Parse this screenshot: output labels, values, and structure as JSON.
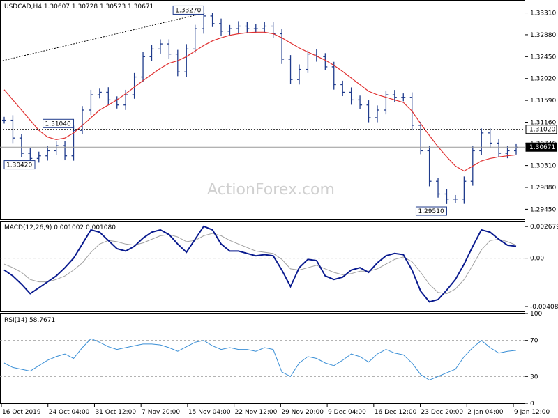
{
  "chart_data": [
    {
      "type": "ohlc",
      "info": "USDCAD,H4  1.30607 1.30728 1.30523 1.30671",
      "ylim": [
        1.2925,
        1.3355
      ],
      "y_ticks": [
        "1.33310",
        "1.32880",
        "1.32450",
        "1.32020",
        "1.31590",
        "1.31160",
        "1.30740",
        "1.30310",
        "1.29880",
        "1.29450"
      ],
      "current_price": "1.30671",
      "level_line": "1.31020",
      "annotations": [
        {
          "text": "1.33270",
          "value": 1.3327
        },
        {
          "text": "1.30420",
          "value": 1.3042
        },
        {
          "text": "1.31040",
          "value": 1.3104
        },
        {
          "text": "1.29510",
          "value": 1.2951
        }
      ],
      "series": [
        {
          "name": "close",
          "values": [
            1.312,
            1.3085,
            1.3055,
            1.3045,
            1.305,
            1.306,
            1.307,
            1.305,
            1.31,
            1.314,
            1.317,
            1.3175,
            1.316,
            1.315,
            1.317,
            1.3205,
            1.3245,
            1.326,
            1.327,
            1.325,
            1.3215,
            1.326,
            1.33,
            1.3325,
            1.331,
            1.3295,
            1.33,
            1.3305,
            1.33,
            1.33,
            1.3305,
            1.329,
            1.324,
            1.32,
            1.322,
            1.325,
            1.3245,
            1.3225,
            1.319,
            1.3175,
            1.316,
            1.315,
            1.3125,
            1.314,
            1.317,
            1.3165,
            1.3165,
            1.311,
            1.306,
            1.3,
            1.2975,
            1.2965,
            1.2965,
            1.3,
            1.306,
            1.3095,
            1.3075,
            1.3055,
            1.306,
            1.3067
          ]
        },
        {
          "name": "moving average",
          "values": [
            1.318,
            1.316,
            1.314,
            1.312,
            1.31,
            1.3087,
            1.3082,
            1.3085,
            1.3095,
            1.311,
            1.3125,
            1.314,
            1.315,
            1.316,
            1.3172,
            1.3185,
            1.3198,
            1.321,
            1.3222,
            1.3232,
            1.3237,
            1.3245,
            1.3256,
            1.3267,
            1.3276,
            1.3282,
            1.3287,
            1.329,
            1.3292,
            1.3293,
            1.3293,
            1.329,
            1.3282,
            1.3272,
            1.3262,
            1.3254,
            1.3246,
            1.3238,
            1.3228,
            1.3216,
            1.3203,
            1.319,
            1.3177,
            1.317,
            1.3165,
            1.316,
            1.3155,
            1.3138,
            1.3113,
            1.309,
            1.3068,
            1.3048,
            1.303,
            1.302,
            1.303,
            1.304,
            1.3045,
            1.3048,
            1.305,
            1.3052
          ]
        }
      ]
    },
    {
      "type": "line",
      "info": "MACD(12,26,9) 0.001002 0.001080",
      "ylim": [
        -0.0045,
        0.0031
      ],
      "y_ticks": [
        "0.002679",
        "0.00",
        "-0.004086"
      ],
      "series": [
        {
          "name": "MACD",
          "values": [
            -0.001,
            -0.0015,
            -0.0022,
            -0.003,
            -0.0025,
            -0.002,
            -0.0015,
            -0.0008,
            0.0,
            0.0012,
            0.0024,
            0.0022,
            0.0015,
            0.0008,
            0.0006,
            0.001,
            0.0017,
            0.0022,
            0.0024,
            0.002,
            0.0012,
            0.0005,
            0.0016,
            0.0027,
            0.0024,
            0.0012,
            0.0006,
            0.0006,
            0.0004,
            0.0002,
            0.0003,
            0.0002,
            -0.001,
            -0.0024,
            -0.0008,
            -0.0001,
            -0.0002,
            -0.0015,
            -0.0018,
            -0.0016,
            -0.001,
            -0.0008,
            -0.0012,
            -0.0004,
            0.0002,
            0.0004,
            0.0003,
            -0.001,
            -0.0028,
            -0.0037,
            -0.0035,
            -0.0027,
            -0.0018,
            -0.0005,
            0.001,
            0.0024,
            0.0022,
            0.0016,
            0.0011,
            0.001
          ]
        },
        {
          "name": "signal",
          "values": [
            -0.0005,
            -0.0008,
            -0.0012,
            -0.0018,
            -0.002,
            -0.002,
            -0.0018,
            -0.0015,
            -0.001,
            -0.0004,
            0.0005,
            0.0012,
            0.0015,
            0.0014,
            0.0012,
            0.0011,
            0.0013,
            0.0016,
            0.0019,
            0.002,
            0.0018,
            0.0014,
            0.0015,
            0.0019,
            0.0021,
            0.0019,
            0.0015,
            0.0012,
            0.0009,
            0.0006,
            0.0005,
            0.0004,
            -0.0001,
            -0.0009,
            -0.001,
            -0.0008,
            -0.0006,
            -0.0009,
            -0.0012,
            -0.0014,
            -0.0013,
            -0.0011,
            -0.0011,
            -0.0009,
            -0.0005,
            -0.0001,
            0.0001,
            -0.0003,
            -0.0012,
            -0.0022,
            -0.0029,
            -0.003,
            -0.0026,
            -0.0018,
            -0.0006,
            0.0007,
            0.0015,
            0.0016,
            0.0014,
            0.0011
          ]
        }
      ]
    },
    {
      "type": "line",
      "info": "RSI(14) 58.7671",
      "ylim": [
        0,
        100
      ],
      "y_ticks": [
        "100",
        "70",
        "30",
        "0"
      ],
      "series": [
        {
          "name": "RSI",
          "values": [
            45,
            40,
            38,
            36,
            42,
            48,
            52,
            55,
            50,
            62,
            72,
            68,
            63,
            60,
            62,
            64,
            66,
            66,
            65,
            62,
            58,
            63,
            68,
            70,
            64,
            60,
            62,
            60,
            60,
            58,
            62,
            60,
            35,
            30,
            45,
            52,
            50,
            45,
            42,
            48,
            55,
            52,
            46,
            55,
            60,
            56,
            54,
            45,
            32,
            26,
            30,
            34,
            38,
            52,
            62,
            70,
            62,
            56,
            58,
            59
          ]
        }
      ]
    }
  ],
  "x_ticks": [
    "16 Oct 2019",
    "24 Oct 04:00",
    "31 Oct 12:00",
    "7 Nov 20:00",
    "15 Nov 04:00",
    "22 Nov 12:00",
    "29 Nov 20:00",
    "9 Dec 04:00",
    "16 Dec 12:00",
    "23 Dec 20:00",
    "2 Jan 04:00",
    "9 Jan 12:00"
  ],
  "watermark": "ActionForex.com",
  "colors": {
    "price_bars": "#1f3b8c",
    "moving_average": "#e03030",
    "macd": "#0a1b8f",
    "signal": "#a0a0a0",
    "rsi": "#3a8fd6",
    "frame": "#000000",
    "dashed": "#808080"
  }
}
